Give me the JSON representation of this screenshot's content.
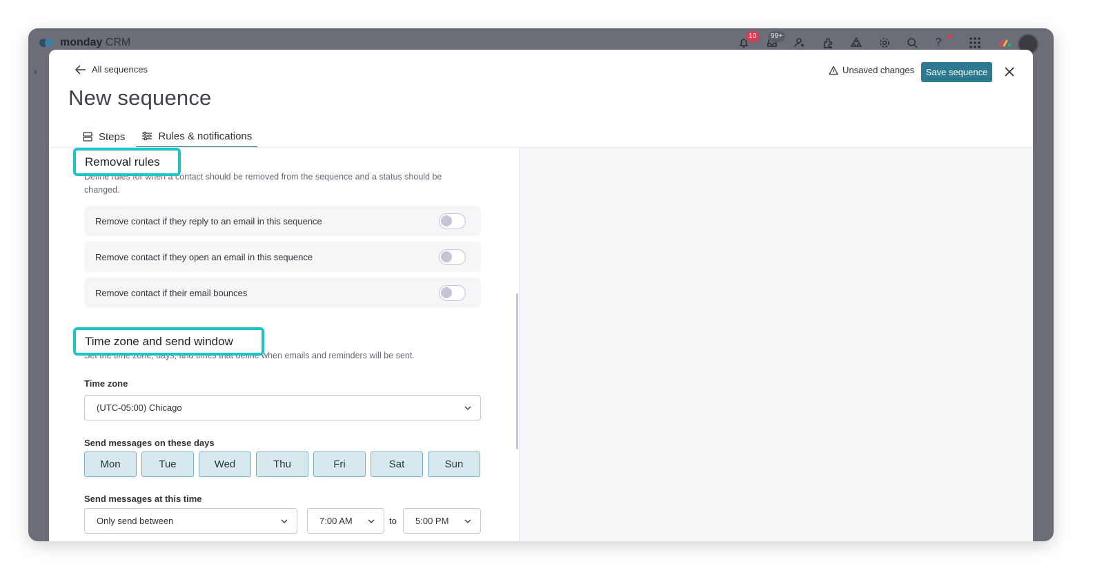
{
  "app": {
    "brand": "monday",
    "product": "CRM",
    "notifications_count": "10",
    "inbox_count": "99+"
  },
  "header": {
    "back_label": "All sequences",
    "title": "New sequence",
    "unsaved_label": "Unsaved changes",
    "save_label": "Save sequence"
  },
  "tabs": [
    {
      "label": "Steps",
      "icon": "list-icon"
    },
    {
      "label": "Rules & notifications",
      "icon": "sliders-icon",
      "active": true
    }
  ],
  "removal_rules": {
    "title": "Removal rules",
    "description": "Define rules for when a contact should be removed from the sequence and a status should be changed.",
    "rules": [
      {
        "label": "Remove contact if they reply to an email in this sequence",
        "enabled": false
      },
      {
        "label": "Remove contact if they open an email in this sequence",
        "enabled": false
      },
      {
        "label": "Remove contact if their email bounces",
        "enabled": false
      }
    ]
  },
  "time_zone_section": {
    "title": "Time zone and send window",
    "description": "Set the time zone, days, and times that define when emails and reminders will be sent.",
    "time_zone_label": "Time zone",
    "time_zone_value": "(UTC-05:00) Chicago",
    "days_label": "Send messages on these days",
    "days": [
      "Mon",
      "Tue",
      "Wed",
      "Thu",
      "Fri",
      "Sat",
      "Sun"
    ],
    "time_label": "Send messages at this time",
    "send_mode": "Only send between",
    "start_time": "7:00 AM",
    "to_label": "to",
    "end_time": "5:00 PM"
  },
  "colors": {
    "accent": "#2d7a90",
    "highlight": "#1fc4c9",
    "day_selected_bg": "#d6e9ef"
  }
}
